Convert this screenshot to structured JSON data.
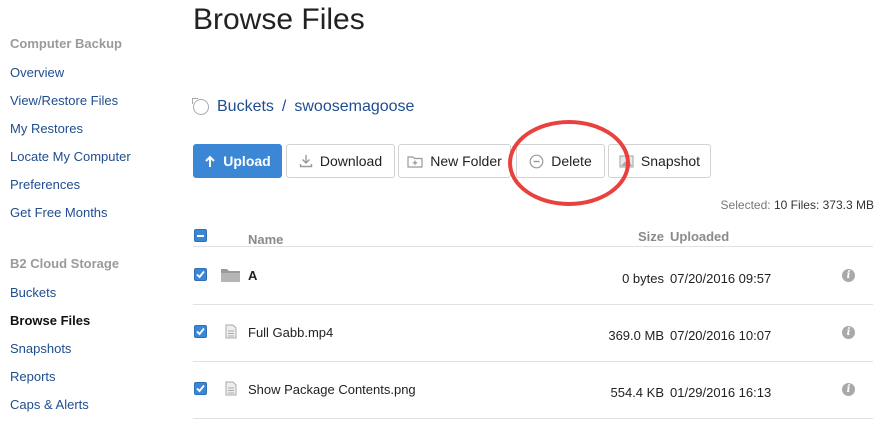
{
  "sidebar": {
    "section1": "Computer Backup",
    "items1": [
      "Overview",
      "View/Restore Files",
      "My Restores",
      "Locate My Computer",
      "Preferences",
      "Get Free Months"
    ],
    "section2": "B2 Cloud Storage",
    "items2": [
      "Buckets",
      "Browse Files",
      "Snapshots",
      "Reports",
      "Caps & Alerts"
    ],
    "active": "Browse Files"
  },
  "page_title": "Browse Files",
  "breadcrumb": {
    "root": "Buckets",
    "separator": "/",
    "bucket": "swoosemagoose",
    "icon": "refresh-icon"
  },
  "toolbar": {
    "upload": "Upload",
    "download": "Download",
    "new_folder": "New Folder",
    "delete": "Delete",
    "snapshot": "Snapshot"
  },
  "selection": {
    "label": "Selected:",
    "value": "10 Files: 373.3 MB"
  },
  "table": {
    "headers": {
      "name": "Name",
      "size": "Size",
      "uploaded": "Uploaded"
    },
    "rows": [
      {
        "type": "folder",
        "name": "A",
        "size": "0 bytes",
        "uploaded": "07/20/2016 09:57",
        "checked": true
      },
      {
        "type": "file",
        "name": "Full Gabb.mp4",
        "size": "369.0 MB",
        "uploaded": "07/20/2016 10:07",
        "checked": true
      },
      {
        "type": "file",
        "name": "Show Package Contents.png",
        "size": "554.4 KB",
        "uploaded": "01/29/2016 16:13",
        "checked": true
      }
    ]
  },
  "colors": {
    "link": "#1f4d8f",
    "primary": "#3b87d6",
    "annotation": "#e8413e"
  }
}
